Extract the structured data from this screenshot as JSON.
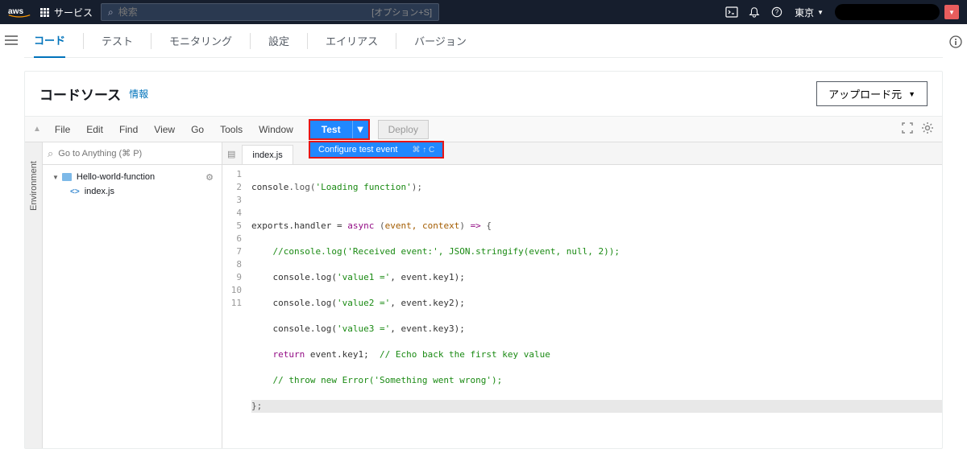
{
  "header": {
    "logo_alt": "aws",
    "services_label": "サービス",
    "search_placeholder": "検索",
    "search_hint": "[オプション+S]",
    "region_label": "東京"
  },
  "func_tabs": [
    {
      "label": "コード",
      "active": true
    },
    {
      "label": "テスト",
      "active": false
    },
    {
      "label": "モニタリング",
      "active": false
    },
    {
      "label": "設定",
      "active": false
    },
    {
      "label": "エイリアス",
      "active": false
    },
    {
      "label": "バージョン",
      "active": false
    }
  ],
  "panel": {
    "title": "コードソース",
    "info_label": "情報",
    "upload_label": "アップロード元"
  },
  "ide_menu": [
    "File",
    "Edit",
    "Find",
    "View",
    "Go",
    "Tools",
    "Window"
  ],
  "test_button_label": "Test",
  "deploy_button_label": "Deploy",
  "env_tab_label": "Environment",
  "search_placeholder": "Go to Anything (⌘ P)",
  "file_tree": {
    "root": "Hello-world-function",
    "children": [
      "index.js"
    ]
  },
  "editor_tab_name": "index.js",
  "dropdown": {
    "item_label": "Configure test event",
    "shortcut": "⌘ ↑ C"
  },
  "gutter_lines": [
    "1",
    "2",
    "3",
    "4",
    "5",
    "6",
    "7",
    "8",
    "9",
    "10",
    "11"
  ],
  "code": {
    "l1": {
      "a": "console",
      "b": ".log(",
      "c": "'Loading function'",
      "d": ");"
    },
    "l2": "",
    "l3": {
      "a": "exports.handler = ",
      "b": "async",
      "c": " (",
      "d": "event, context",
      "e": ") ",
      "f": "=>",
      "g": " {"
    },
    "l4": {
      "a": "    ",
      "b": "//console.log('Received event:', JSON.stringify(event, null, 2));"
    },
    "l5": {
      "a": "    console.log(",
      "b": "'value1 ='",
      "c": ", event.key1);"
    },
    "l6": {
      "a": "    console.log(",
      "b": "'value2 ='",
      "c": ", event.key2);"
    },
    "l7": {
      "a": "    console.log(",
      "b": "'value3 ='",
      "c": ", event.key3);"
    },
    "l8": {
      "a": "    ",
      "b": "return",
      "c": " event.key1;  ",
      "d": "// Echo back the first key value"
    },
    "l9": {
      "a": "    ",
      "b": "// throw new Error('Something went wrong');"
    },
    "l10": "};",
    "l11": ""
  }
}
